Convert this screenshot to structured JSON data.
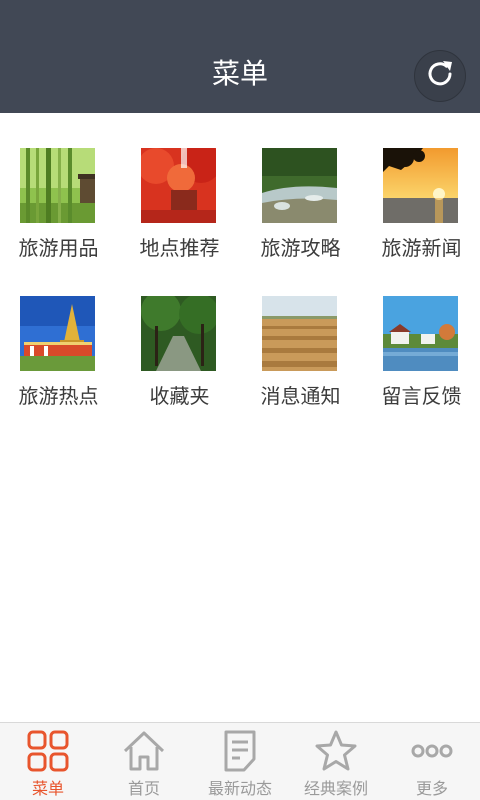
{
  "header": {
    "title": "菜单"
  },
  "grid": {
    "items": [
      {
        "label": "旅游用品",
        "image": "bamboo-forest"
      },
      {
        "label": "地点推荐",
        "image": "red-maple-trees"
      },
      {
        "label": "旅游攻略",
        "image": "forest-stream"
      },
      {
        "label": "旅游新闻",
        "image": "sunset-lake"
      },
      {
        "label": "旅游热点",
        "image": "golden-pagoda"
      },
      {
        "label": "收藏夹",
        "image": "tree-path"
      },
      {
        "label": "消息通知",
        "image": "plowed-field"
      },
      {
        "label": "留言反馈",
        "image": "lakeside-village"
      }
    ]
  },
  "tabbar": {
    "accent_color": "#e8552d",
    "inactive_color": "#9a9a9a",
    "tabs": [
      {
        "label": "菜单",
        "icon": "grid-icon",
        "active": true
      },
      {
        "label": "首页",
        "icon": "home-icon",
        "active": false
      },
      {
        "label": "最新动态",
        "icon": "document-icon",
        "active": false
      },
      {
        "label": "经典案例",
        "icon": "star-icon",
        "active": false
      },
      {
        "label": "更多",
        "icon": "more-icon",
        "active": false
      }
    ]
  }
}
